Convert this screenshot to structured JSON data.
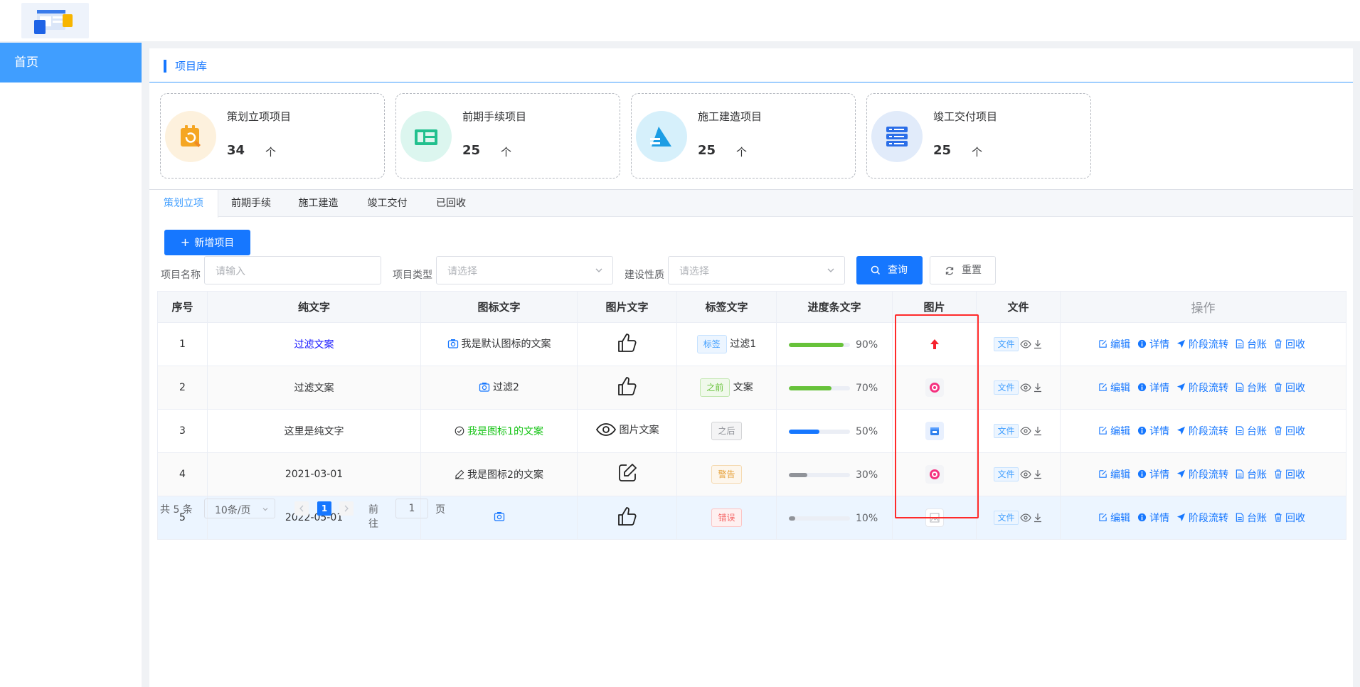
{
  "sidebar": {
    "home": "首页"
  },
  "header": {
    "title": "项目库"
  },
  "stats": [
    {
      "label": "策划立项项目",
      "count": "34",
      "unit": "个"
    },
    {
      "label": "前期手续项目",
      "count": "25",
      "unit": "个"
    },
    {
      "label": "施工建造项目",
      "count": "25",
      "unit": "个"
    },
    {
      "label": "竣工交付项目",
      "count": "25",
      "unit": "个"
    }
  ],
  "tabs": [
    "策划立项",
    "前期手续",
    "施工建造",
    "竣工交付",
    "已回收"
  ],
  "toolbar": {
    "add_label": "新增项目"
  },
  "filters": {
    "name_label": "项目名称",
    "name_placeholder": "请输入",
    "type_label": "项目类型",
    "type_placeholder": "请选择",
    "nature_label": "建设性质",
    "nature_placeholder": "请选择",
    "query_label": "查询",
    "reset_label": "重置"
  },
  "table": {
    "headers": [
      "序号",
      "纯文字",
      "图标文字",
      "图片文字",
      "标签文字",
      "进度条文字",
      "图片",
      "文件",
      "操作"
    ],
    "rows": [
      {
        "index": "1",
        "plain": "过滤文案",
        "icon_text": "我是默认图标的文案",
        "img_text": "",
        "tag": "标签",
        "tag_suffix": "过滤1",
        "progress": "90%",
        "file": "文件"
      },
      {
        "index": "2",
        "plain": "过滤文案",
        "icon_text": "过滤2",
        "img_text": "",
        "tag": "之前",
        "tag_suffix": "文案",
        "progress": "70%",
        "file": "文件"
      },
      {
        "index": "3",
        "plain": "这里是纯文字",
        "icon_text": "我是图标1的文案",
        "img_text": "图片文案",
        "tag": "之后",
        "tag_suffix": "",
        "progress": "50%",
        "file": "文件"
      },
      {
        "index": "4",
        "plain": "2021-03-01",
        "icon_text": "我是图标2的文案",
        "img_text": "",
        "tag": "警告",
        "tag_suffix": "",
        "progress": "30%",
        "file": "文件"
      },
      {
        "index": "5",
        "plain": "2022-05-01",
        "icon_text": "",
        "img_text": "",
        "tag": "错误",
        "tag_suffix": "",
        "progress": "10%",
        "file": "文件"
      }
    ],
    "ops": [
      "编辑",
      "详情",
      "阶段流转",
      "台账",
      "回收"
    ]
  },
  "pagination": {
    "total": "共 5 条",
    "size": "10条/页",
    "current": "1",
    "goto": "前往",
    "goto_value": "1",
    "page": "页"
  },
  "colors": {
    "primary": "#1677ff",
    "success": "#67c23a",
    "highlight": "#ff2a2a"
  }
}
